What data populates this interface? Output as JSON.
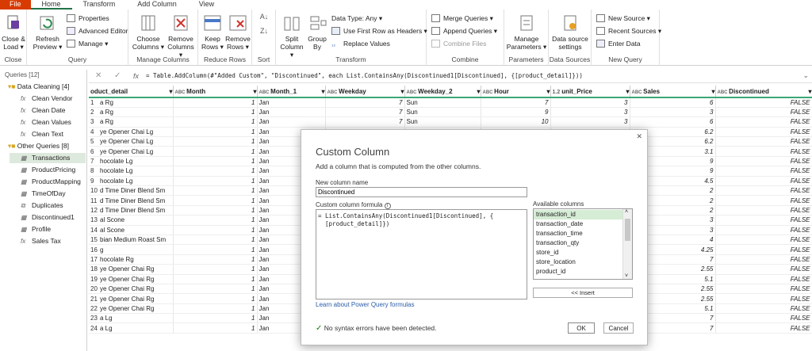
{
  "tabs": [
    "File",
    "Home",
    "Transform",
    "Add Column",
    "View"
  ],
  "ribbon": {
    "close_load": "Close &\nLoad ▾",
    "refresh": "Refresh\nPreview ▾",
    "properties": "Properties",
    "advanced_editor": "Advanced Editor",
    "manage": "Manage ▾",
    "choose_columns": "Choose\nColumns ▾",
    "remove_columns": "Remove\nColumns ▾",
    "keep_rows": "Keep\nRows ▾",
    "remove_rows": "Remove\nRows ▾",
    "split_column": "Split\nColumn ▾",
    "group_by": "Group\nBy",
    "data_type": "Data Type: Any ▾",
    "first_row": "Use First Row as Headers ▾",
    "replace_values": "Replace Values",
    "merge_queries": "Merge Queries ▾",
    "append_queries": "Append Queries ▾",
    "combine_files": "Combine Files",
    "manage_parameters": "Manage\nParameters ▾",
    "data_source": "Data source\nsettings",
    "new_source": "New Source ▾",
    "recent_sources": "Recent Sources ▾",
    "enter_data": "Enter Data",
    "groups": [
      "Close",
      "Query",
      "Manage Columns",
      "Reduce Rows",
      "Sort",
      "Transform",
      "Combine",
      "Parameters",
      "Data Sources",
      "New Query"
    ]
  },
  "queries": {
    "header": "Queries [12]",
    "folders": [
      "Data Cleaning [4]",
      "Other Queries [8]"
    ],
    "clean": [
      "Clean Vendor",
      "Clean Date",
      "Clean Values",
      "Clean Text"
    ],
    "other": [
      "Transactions",
      "ProductPricing",
      "ProductMapping",
      "TimeOfDay",
      "Duplicates",
      "Discontinued1",
      "Profile",
      "Sales Tax"
    ]
  },
  "formula": "= Table.AddColumn(#\"Added Custom\", \"Discontinued\", each List.ContainsAny(Discontinued1[Discontinued], {[product_detail]}))",
  "columns": [
    "oduct_detail",
    "Month",
    "Month_1",
    "Weekday",
    "Weekday_2",
    "Hour",
    "unit_Price",
    "Sales",
    "Discontinued"
  ],
  "rows": [
    [
      "1",
      "a Rg",
      "1",
      "Jan",
      "7",
      "Sun",
      "7",
      "3",
      "6",
      "FALSE"
    ],
    [
      "2",
      "a Rg",
      "1",
      "Jan",
      "7",
      "Sun",
      "9",
      "3",
      "3",
      "FALSE"
    ],
    [
      "3",
      "a Rg",
      "1",
      "Jan",
      "7",
      "Sun",
      "10",
      "3",
      "6",
      "FALSE"
    ],
    [
      "4",
      "ye Opener Chai Lg",
      "1",
      "Jan",
      "",
      "",
      "",
      "",
      "6.2",
      "FALSE"
    ],
    [
      "5",
      "ye Opener Chai Lg",
      "1",
      "Jan",
      "",
      "",
      "",
      "",
      "6.2",
      "FALSE"
    ],
    [
      "6",
      "ye Opener Chai Lg",
      "1",
      "Jan",
      "",
      "",
      "",
      "",
      "3.1",
      "FALSE"
    ],
    [
      "7",
      "hocolate Lg",
      "1",
      "Jan",
      "",
      "",
      "",
      "",
      "9",
      "FALSE"
    ],
    [
      "8",
      "hocolate Lg",
      "1",
      "Jan",
      "",
      "",
      "",
      "",
      "9",
      "FALSE"
    ],
    [
      "9",
      "hocolate Lg",
      "1",
      "Jan",
      "",
      "",
      "",
      "",
      "4.5",
      "FALSE"
    ],
    [
      "10",
      "d Time Diner Blend Sm",
      "1",
      "Jan",
      "",
      "",
      "",
      "",
      "2",
      "FALSE"
    ],
    [
      "11",
      "d Time Diner Blend Sm",
      "1",
      "Jan",
      "",
      "",
      "",
      "",
      "2",
      "FALSE"
    ],
    [
      "12",
      "d Time Diner Blend Sm",
      "1",
      "Jan",
      "",
      "",
      "",
      "",
      "2",
      "FALSE"
    ],
    [
      "13",
      "al Scone",
      "1",
      "Jan",
      "",
      "",
      "",
      "",
      "3",
      "FALSE"
    ],
    [
      "14",
      "al Scone",
      "1",
      "Jan",
      "",
      "",
      "",
      "",
      "3",
      "FALSE"
    ],
    [
      "15",
      "bian Medium Roast Sm",
      "1",
      "Jan",
      "",
      "",
      "",
      "",
      "4",
      "FALSE"
    ],
    [
      "16",
      "g",
      "1",
      "Jan",
      "",
      "",
      "",
      "",
      "4.25",
      "FALSE"
    ],
    [
      "17",
      "hocolate Rg",
      "1",
      "Jan",
      "",
      "",
      "",
      "",
      "7",
      "FALSE"
    ],
    [
      "18",
      "ye Opener Chai Rg",
      "1",
      "Jan",
      "",
      "",
      "",
      "",
      "2.55",
      "FALSE"
    ],
    [
      "19",
      "ye Opener Chai Rg",
      "1",
      "Jan",
      "",
      "",
      "",
      "",
      "5.1",
      "FALSE"
    ],
    [
      "20",
      "ye Opener Chai Rg",
      "1",
      "Jan",
      "",
      "",
      "",
      "",
      "2.55",
      "FALSE"
    ],
    [
      "21",
      "ye Opener Chai Rg",
      "1",
      "Jan",
      "",
      "",
      "",
      "",
      "2.55",
      "FALSE"
    ],
    [
      "22",
      "ye Opener Chai Rg",
      "1",
      "Jan",
      "",
      "",
      "",
      "",
      "5.1",
      "FALSE"
    ],
    [
      "23",
      "a Lg",
      "1",
      "Jan",
      "",
      "",
      "",
      "",
      "7",
      "FALSE"
    ],
    [
      "24",
      "a Lg",
      "1",
      "Jan",
      "",
      "",
      "",
      "",
      "7",
      "FALSE"
    ]
  ],
  "dialog": {
    "title": "Custom Column",
    "subtitle": "Add a column that is computed from the other columns.",
    "name_label": "New column name",
    "name_value": "Discontinued",
    "formula_label": "Custom column formula",
    "formula_text": "= List.ContainsAny(Discontinued1[Discontinued], {\n  [product_detail]})",
    "available_label": "Available columns",
    "available": [
      "transaction_id",
      "transaction_date",
      "transaction_time",
      "transaction_qty",
      "store_id",
      "store_location",
      "product_id"
    ],
    "insert": "<< Insert",
    "learn": "Learn about Power Query formulas",
    "status": "No syntax errors have been detected.",
    "ok": "OK",
    "cancel": "Cancel"
  },
  "colors": {
    "accent": "#217346",
    "file": "#d83b01",
    "header_line": "#3aa776"
  }
}
